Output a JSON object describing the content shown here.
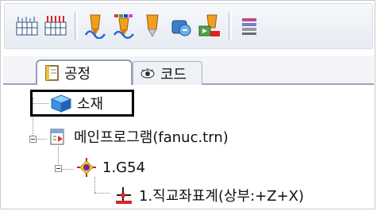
{
  "toolbar": {
    "buttons": [
      {
        "icon": "grid-ruler-icon"
      },
      {
        "icon": "red-grid-ruler-icon"
      },
      {
        "icon": "tool-path-orange-icon"
      },
      {
        "icon": "tool-path-multicolor-icon"
      },
      {
        "icon": "drill-tool-icon"
      },
      {
        "icon": "simulation-blue-icon"
      },
      {
        "icon": "tool-export-icon"
      },
      {
        "icon": "list-stack-icon"
      }
    ]
  },
  "tabs": [
    {
      "label": "공정",
      "active": true,
      "icon": "notebook-icon"
    },
    {
      "label": "코드",
      "active": false,
      "icon": "eye-icon"
    }
  ],
  "tree": {
    "material": {
      "label": "소재",
      "icon": "material-cube-icon"
    },
    "program": {
      "label": "메인프로그램(fanuc.trn)",
      "icon": "program-file-icon"
    },
    "coordinate": {
      "label": "1.G54",
      "icon": "coordinate-origin-icon"
    },
    "plane": {
      "label": "1.직교좌표계(상부:+Z+X)",
      "icon": "plane-axis-icon"
    }
  },
  "colors": {
    "selection_border": "#000000",
    "tab_border": "#8fa0b5",
    "toolbar_bg": "#e6ebf2"
  }
}
